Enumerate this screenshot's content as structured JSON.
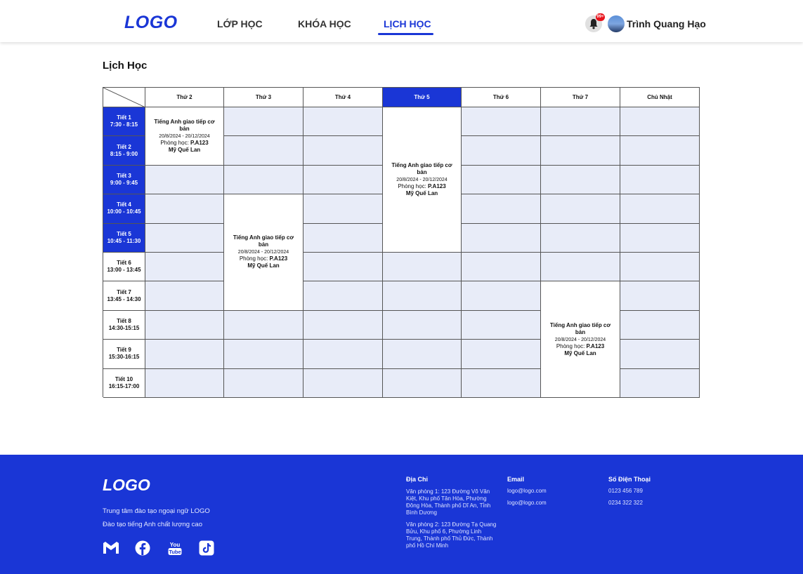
{
  "header": {
    "logo": "LOGO",
    "nav": [
      {
        "label": "LỚP HỌC"
      },
      {
        "label": "KHÓA HỌC"
      },
      {
        "label": "LỊCH HỌC"
      }
    ],
    "notification_badge": "99+",
    "username": "Trình Quang Hạo",
    "accent_color": "#1a36d6"
  },
  "page_title": "Lịch Học",
  "timetable": {
    "days": [
      "Thứ 2",
      "Thứ 3",
      "Thứ 4",
      "Thứ 5",
      "Thứ 6",
      "Thứ 7",
      "Chủ Nhật"
    ],
    "active_day": "Thứ 5",
    "periods": [
      {
        "name": "Tiết 1",
        "time": "7:30 - 8:15"
      },
      {
        "name": "Tiết 2",
        "time": "8:15 - 9:00"
      },
      {
        "name": "Tiết 3",
        "time": "9:00 - 9:45"
      },
      {
        "name": "Tiết 4",
        "time": "10:00 - 10:45"
      },
      {
        "name": "Tiết 5",
        "time": "10:45 - 11:30"
      },
      {
        "name": "Tiết 6",
        "time": "13:00 - 13:45"
      },
      {
        "name": "Tiết 7",
        "time": "13:45 - 14:30"
      },
      {
        "name": "Tiết 8",
        "time": "14:30-15:15"
      },
      {
        "name": "Tiết 9",
        "time": "15:30-16:15"
      },
      {
        "name": "Tiết 10",
        "time": "16:15-17:00"
      }
    ],
    "events": [
      {
        "day": 0,
        "start": 0,
        "span": 2,
        "title": "Tiếng Anh giao tiếp cơ bản",
        "dates": "20/8/2024 - 20/12/2024",
        "room_label": "Phòng học:",
        "room": "P.A123",
        "teacher": "Mỹ Quế Lan"
      },
      {
        "day": 1,
        "start": 3,
        "span": 4,
        "title": "Tiếng Anh giao tiếp cơ bản",
        "dates": "20/8/2024 - 20/12/2024",
        "room_label": "Phòng học:",
        "room": "P.A123",
        "teacher": "Mỹ Quế Lan"
      },
      {
        "day": 3,
        "start": 0,
        "span": 5,
        "title": "Tiếng Anh giao tiếp cơ bản",
        "dates": "20/8/2024 - 20/12/2024",
        "room_label": "Phòng học:",
        "room": "P.A123",
        "teacher": "Mỹ Quế Lan"
      },
      {
        "day": 5,
        "start": 6,
        "span": 4,
        "title": "Tiếng Anh giao tiếp cơ bản",
        "dates": "20/8/2024 - 20/12/2024",
        "room_label": "Phòng học:",
        "room": "P.A123",
        "teacher": "Mỹ Quế Lan"
      }
    ]
  },
  "footer": {
    "logo": "LOGO",
    "desc1": "Trung tâm đào tạo ngoại ngữ LOGO",
    "desc2": "Đào tạo tiếng Anh chất lượng cao",
    "social_icons": [
      "gmail-icon",
      "facebook-icon",
      "youtube-icon",
      "tiktok-icon"
    ],
    "address_heading": "Địa Chỉ",
    "address1": "Văn phòng 1: 123 Đường Võ Văn Kiệt, Khu phố Tân Hòa, Phường Đông Hòa, Thành phố Dĩ An, Tỉnh  Bình Dương",
    "address2": "Văn phòng 2: 123 Đường Tạ Quang Bửu, Khu phố 6, Phường Linh Trung, Thành phố Thủ Đức, Thành phố Hồ Chí Minh",
    "email_heading": "Email",
    "emails": [
      "logo@logo.com",
      "logo@logo.com"
    ],
    "phone_heading": "Số Điện Thoại",
    "phones": [
      "0123 456 789",
      "0234 322 322"
    ]
  }
}
